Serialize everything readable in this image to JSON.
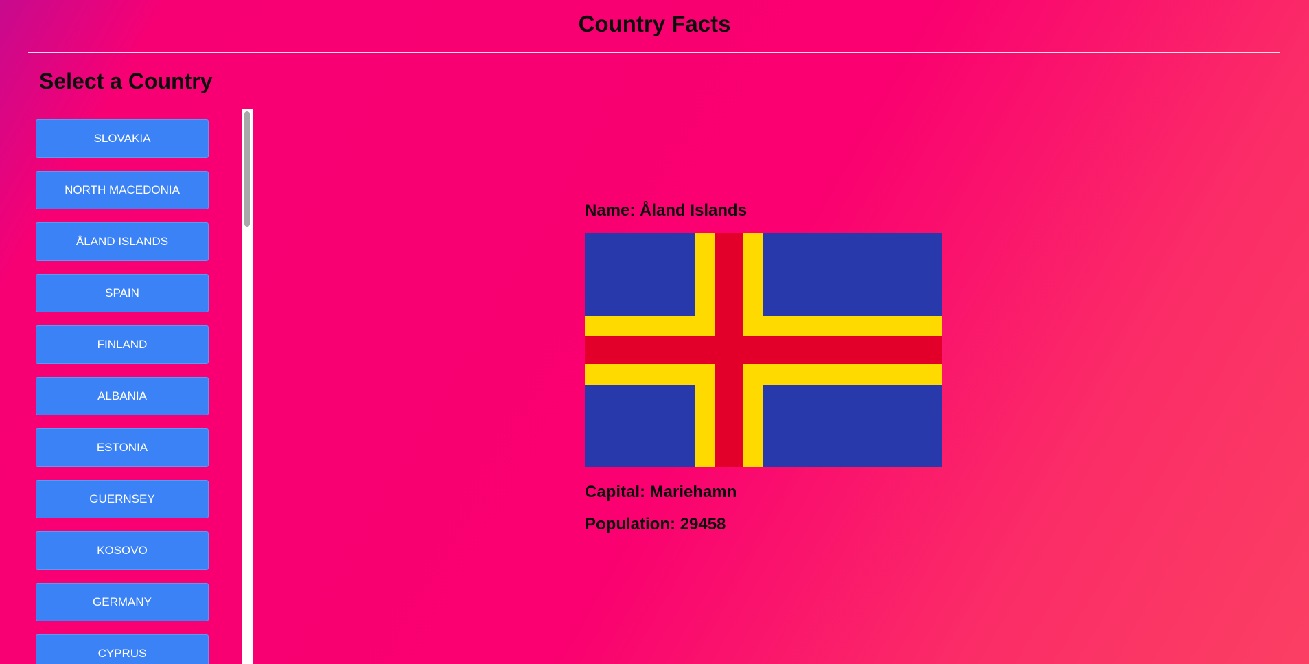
{
  "header": {
    "title": "Country Facts"
  },
  "sidebar": {
    "heading": "Select a Country",
    "countries": [
      "SLOVAKIA",
      "NORTH MACEDONIA",
      "ÅLAND ISLANDS",
      "SPAIN",
      "FINLAND",
      "ALBANIA",
      "ESTONIA",
      "GUERNSEY",
      "KOSOVO",
      "GERMANY",
      "CYPRUS"
    ]
  },
  "details": {
    "name": "Name: Åland Islands",
    "capital": "Capital: Mariehamn",
    "population": "Population: 29458",
    "flag": {
      "icon": "aland-flag",
      "colors": {
        "field": "#2739ab",
        "border_cross": "#ffda00",
        "center_cross": "#e2002b"
      }
    }
  }
}
